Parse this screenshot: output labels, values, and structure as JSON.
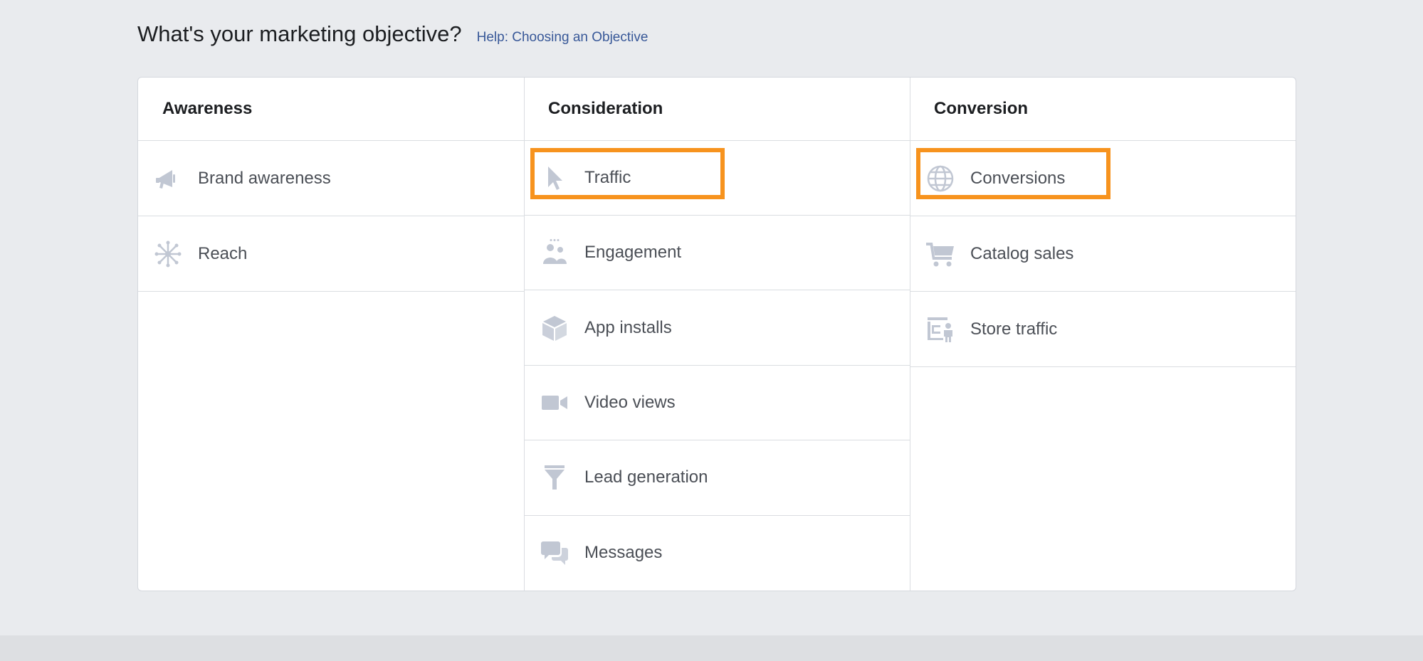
{
  "header": {
    "title": "What's your marketing objective?",
    "help_link": "Help: Choosing an Objective"
  },
  "columns": [
    {
      "heading": "Awareness",
      "items": [
        {
          "label": "Brand awareness",
          "icon": "megaphone-icon"
        },
        {
          "label": "Reach",
          "icon": "reach-icon"
        }
      ]
    },
    {
      "heading": "Consideration",
      "items": [
        {
          "label": "Traffic",
          "icon": "cursor-icon",
          "highlighted": true
        },
        {
          "label": "Engagement",
          "icon": "people-icon"
        },
        {
          "label": "App installs",
          "icon": "box-icon"
        },
        {
          "label": "Video views",
          "icon": "video-camera-icon"
        },
        {
          "label": "Lead generation",
          "icon": "funnel-icon"
        },
        {
          "label": "Messages",
          "icon": "chat-bubbles-icon"
        }
      ]
    },
    {
      "heading": "Conversion",
      "items": [
        {
          "label": "Conversions",
          "icon": "globe-icon",
          "highlighted": true
        },
        {
          "label": "Catalog sales",
          "icon": "shopping-cart-icon"
        },
        {
          "label": "Store traffic",
          "icon": "store-icon"
        }
      ]
    }
  ],
  "colors": {
    "icon": "#c1c7d3",
    "highlight": "#f7931e",
    "link": "#385898",
    "background": "#e9ebee"
  }
}
